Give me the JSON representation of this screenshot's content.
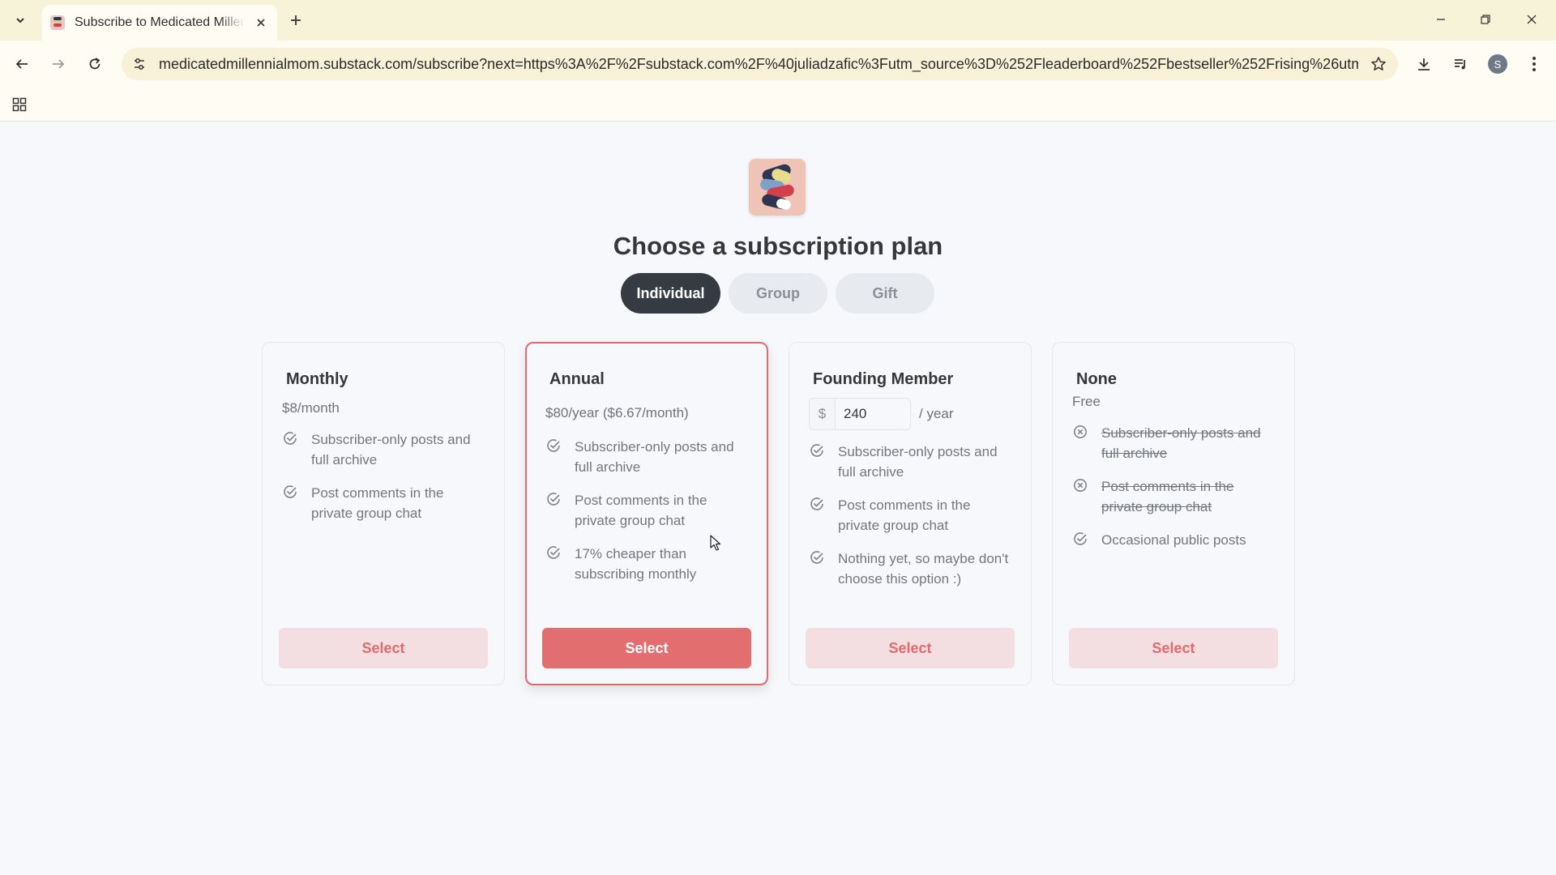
{
  "browser": {
    "tab_title": "Subscribe to Medicated Millennial Mom",
    "url": "medicatedmillennialmom.substack.com/subscribe?next=https%3A%2F%2Fsubstack.com%2F%40juliadzafic%3Futm_source%3D%252Fleaderboard%252Fbestseller%252Frising%26utm_medi...",
    "profile_initial": "S",
    "icons": [
      "tab-search-icon",
      "close-icon",
      "plus-icon",
      "minimize-icon",
      "restore-icon",
      "back-icon",
      "forward-icon",
      "reload-icon",
      "site-info-icon",
      "bookmark-star-icon",
      "download-icon",
      "media-icon",
      "more-icon",
      "apps-icon"
    ]
  },
  "page": {
    "title": "Choose a subscription plan",
    "plan_types": [
      {
        "label": "Individual",
        "active": true
      },
      {
        "label": "Group",
        "active": false
      },
      {
        "label": "Gift",
        "active": false
      }
    ],
    "plans": [
      {
        "name": "Monthly",
        "price": "$8/month",
        "features": [
          {
            "text": "Subscriber-only posts and full archive",
            "included": true
          },
          {
            "text": "Post comments in the private group chat",
            "included": true
          }
        ],
        "button": "Select"
      },
      {
        "name": "Annual",
        "price": "$80/year ($6.67/month)",
        "features": [
          {
            "text": "Subscriber-only posts and full archive",
            "included": true
          },
          {
            "text": "Post comments in the private group chat",
            "included": true
          },
          {
            "text": "17% cheaper than subscribing monthly",
            "included": true
          }
        ],
        "button": "Select",
        "highlighted": true
      },
      {
        "name": "Founding Member",
        "currency": "$",
        "amount": "240",
        "period": "/ year",
        "features": [
          {
            "text": "Subscriber-only posts and full archive",
            "included": true
          },
          {
            "text": "Post comments in the private group chat",
            "included": true
          },
          {
            "text": "Nothing yet, so maybe don't choose this option :)",
            "included": true
          }
        ],
        "button": "Select"
      },
      {
        "name": "None",
        "price": "Free",
        "features": [
          {
            "text": "Subscriber-only posts and full archive",
            "included": false
          },
          {
            "text": "Post comments in the private group chat",
            "included": false
          },
          {
            "text": "Occasional public posts",
            "included": true
          }
        ],
        "button": "Select"
      }
    ]
  },
  "colors": {
    "accent": "#e36e70",
    "accent_light": "#f3dfe1",
    "tab_active": "#363a43",
    "chrome": "#f7f3d9"
  }
}
